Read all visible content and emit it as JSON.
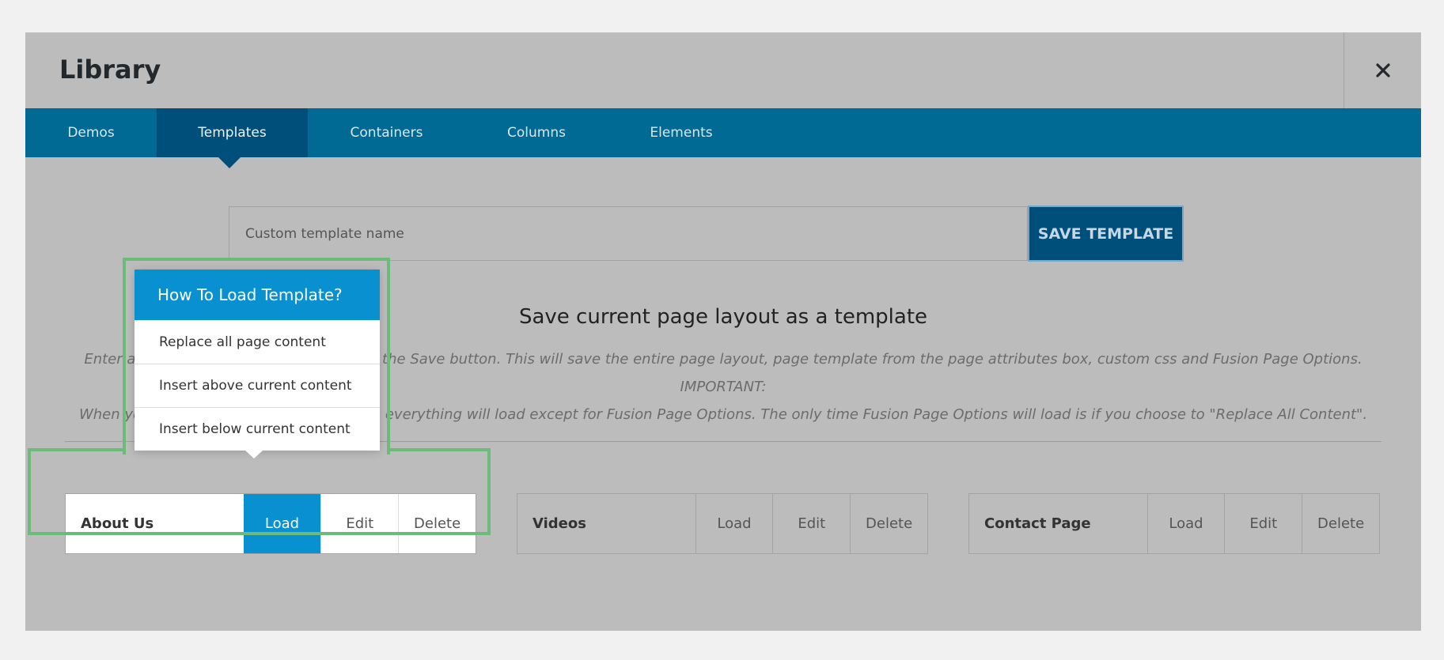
{
  "modal": {
    "title": "Library",
    "close_icon": "close-icon"
  },
  "tabs": [
    {
      "label": "Demos",
      "active": false
    },
    {
      "label": "Templates",
      "active": true
    },
    {
      "label": "Containers",
      "active": false
    },
    {
      "label": "Columns",
      "active": false
    },
    {
      "label": "Elements",
      "active": false
    }
  ],
  "save_form": {
    "placeholder": "Custom template name",
    "value": "",
    "button_label": "SAVE TEMPLATE"
  },
  "section": {
    "heading": "Save current page layout as a template",
    "description_line1": "Enter a name for your template and click the Save button. This will save the entire page layout, page template from the page attributes box, custom css and Fusion Page Options. IMPORTANT:",
    "description_line2": "When you load a template into your page, everything will load except for Fusion Page Options. The only time Fusion Page Options will load is if you choose to \"Replace All Content\"."
  },
  "templates": [
    {
      "name": "About Us",
      "load": "Load",
      "edit": "Edit",
      "delete": "Delete"
    },
    {
      "name": "Videos",
      "load": "Load",
      "edit": "Edit",
      "delete": "Delete"
    },
    {
      "name": "Contact Page",
      "load": "Load",
      "edit": "Edit",
      "delete": "Delete"
    }
  ],
  "popover": {
    "title": "How To Load Template?",
    "options": [
      "Replace all page content",
      "Insert above current content",
      "Insert below current content"
    ]
  },
  "colors": {
    "tab_bar": "#006a95",
    "tab_active": "#004f7b",
    "accent": "#0890d0",
    "highlight": "#6dbb7b",
    "overlay": "#bcbcbc"
  }
}
